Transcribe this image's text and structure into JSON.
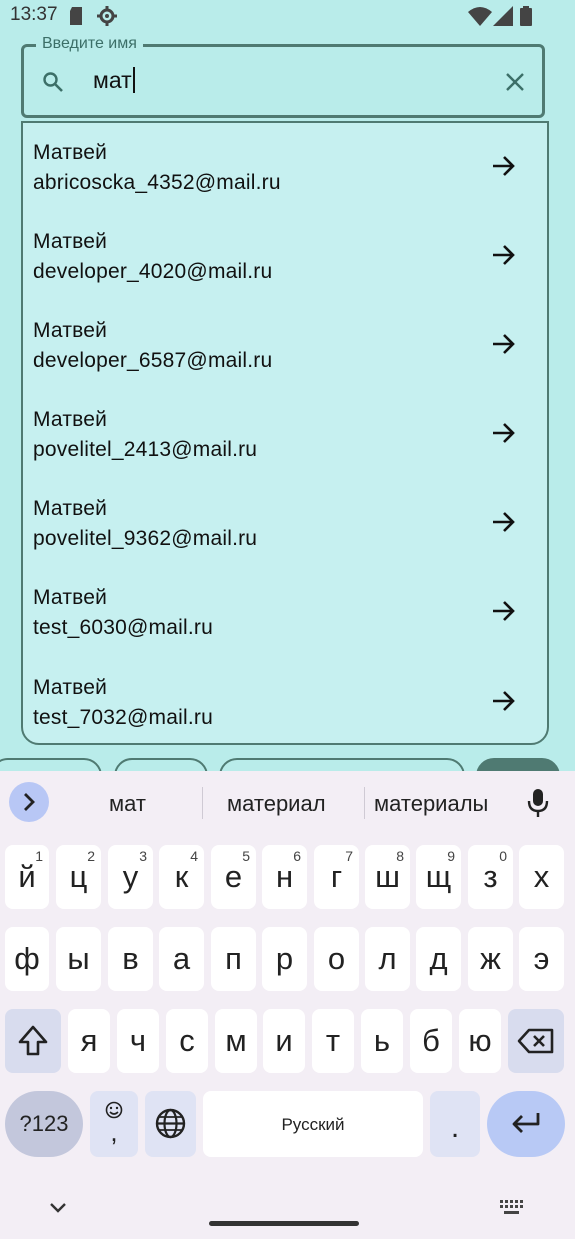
{
  "status_bar": {
    "time": "13:37"
  },
  "search": {
    "label": "Введите имя",
    "value": "мат"
  },
  "results": [
    {
      "name": "Матвей",
      "email": "abricoscka_4352@mail.ru"
    },
    {
      "name": "Матвей",
      "email": "developer_4020@mail.ru"
    },
    {
      "name": "Матвей",
      "email": "developer_6587@mail.ru"
    },
    {
      "name": "Матвей",
      "email": "povelitel_2413@mail.ru"
    },
    {
      "name": "Матвей",
      "email": "povelitel_9362@mail.ru"
    },
    {
      "name": "Матвей",
      "email": "test_6030@mail.ru"
    },
    {
      "name": "Матвей",
      "email": "test_7032@mail.ru"
    }
  ],
  "keyboard": {
    "suggestions": [
      "мат",
      "материал",
      "материалы"
    ],
    "row1": [
      {
        "k": "й",
        "h": "1"
      },
      {
        "k": "ц",
        "h": "2"
      },
      {
        "k": "у",
        "h": "3"
      },
      {
        "k": "к",
        "h": "4"
      },
      {
        "k": "е",
        "h": "5"
      },
      {
        "k": "н",
        "h": "6"
      },
      {
        "k": "г",
        "h": "7"
      },
      {
        "k": "ш",
        "h": "8"
      },
      {
        "k": "щ",
        "h": "9"
      },
      {
        "k": "з",
        "h": "0"
      },
      {
        "k": "х",
        "h": ""
      }
    ],
    "row2": [
      "ф",
      "ы",
      "в",
      "а",
      "п",
      "р",
      "о",
      "л",
      "д",
      "ж",
      "э"
    ],
    "row3": [
      "я",
      "ч",
      "с",
      "м",
      "и",
      "т",
      "ь",
      "б",
      "ю"
    ],
    "symbols_label": "?123",
    "comma_label": ",",
    "space_label": "Русский",
    "period_label": "."
  },
  "colors": {
    "background": "#b9ecea",
    "list_background": "#c6f0f0",
    "outline": "#4f7a72",
    "keyboard_background": "#f3eef5",
    "accent_key": "#b8c9f5"
  },
  "icons": [
    "search-icon",
    "clear-icon",
    "arrow-right-icon",
    "chevron-right-icon",
    "microphone-icon",
    "shift-icon",
    "backspace-icon",
    "emoji-icon",
    "globe-icon",
    "enter-icon",
    "chevron-down-icon",
    "keyboard-icon",
    "wifi-icon",
    "signal-icon",
    "battery-icon",
    "sd-card-icon",
    "settings-icon"
  ]
}
